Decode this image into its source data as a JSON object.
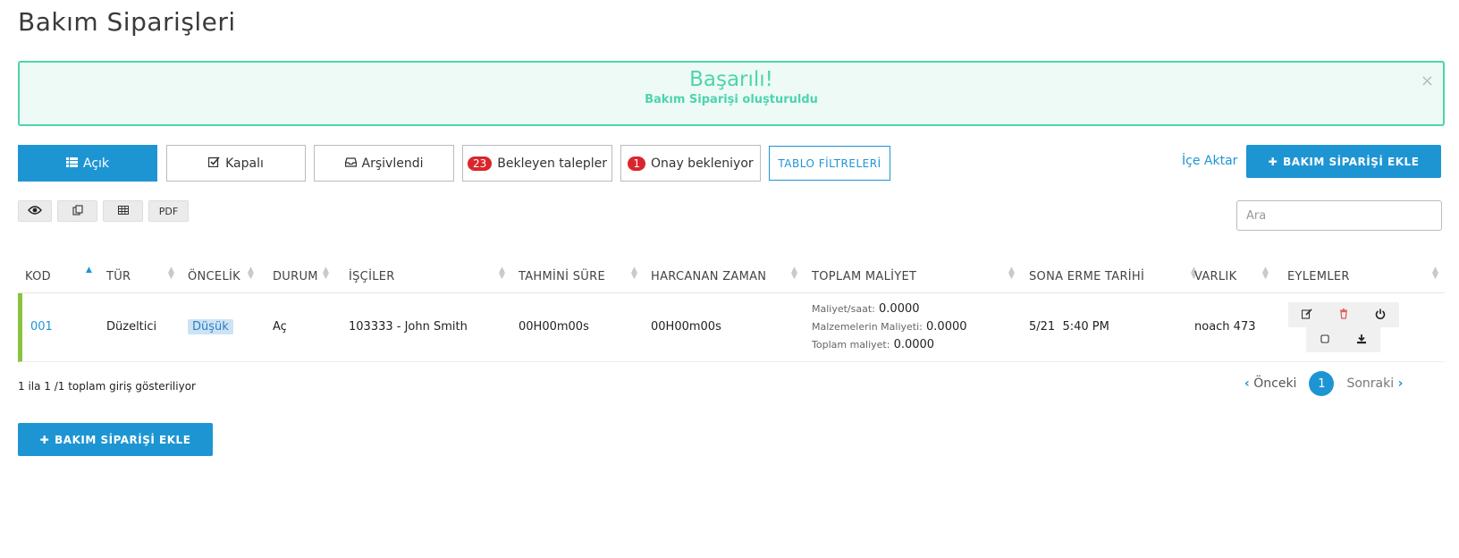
{
  "page": {
    "title": "Bakım Siparişleri"
  },
  "alert": {
    "title": "Başarılı!",
    "message": "Bakım Siparişi oluşturuldu",
    "close": "×"
  },
  "tabs": [
    {
      "label": "Açık",
      "icon": "list-icon",
      "active": true
    },
    {
      "label": "Kapalı",
      "icon": "check-square-icon"
    },
    {
      "label": "Arşivlendi",
      "icon": "inbox-icon"
    },
    {
      "label": "Bekleyen talepler",
      "badge": "23"
    },
    {
      "label": "Onay bekleniyor",
      "badge": "1"
    },
    {
      "label": "TABLO FİLTRELERİ"
    }
  ],
  "header_actions": {
    "import": "İçe Aktar",
    "add_button": "BAKIM SİPARİŞİ EKLE"
  },
  "toolbar": {
    "pdf": "PDF"
  },
  "search": {
    "placeholder": "Ara"
  },
  "table": {
    "columns": [
      "KOD",
      "TÜR",
      "ÖNCELİK",
      "DURUM",
      "İŞÇİLER",
      "TAHMİNİ SÜRE",
      "HARCANAN ZAMAN",
      "TOPLAM MALİYET",
      "SONA ERME TARİHİ",
      "VARLIK",
      "EYLEMLER"
    ],
    "rows": [
      {
        "code": "001",
        "type": "Düzeltici",
        "priority": "Düşük",
        "status": "Aç",
        "workers": "103333 - John Smith",
        "estimated": "00H00m00s",
        "spent": "00H00m00s",
        "cost": {
          "hourly_label": "Maliyet/saat:",
          "hourly": "0.0000",
          "materials_label": "Malzemelerin Maliyeti:",
          "materials": "0.0000",
          "total_label": "Toplam maliyet:",
          "total": "0.0000"
        },
        "due": "5/21  5:40 PM",
        "asset": "noach 473"
      }
    ]
  },
  "footer": {
    "info": "1 ila 1 /1 toplam giriş gösteriliyor",
    "prev": "Önceki",
    "page": "1",
    "next": "Sonraki",
    "add_button": "BAKIM SİPARİŞİ EKLE"
  },
  "colors": {
    "accent": "#1e95d3",
    "success": "#4dd4ac",
    "badge": "#d9262c",
    "row_marker": "#8ac43f"
  }
}
